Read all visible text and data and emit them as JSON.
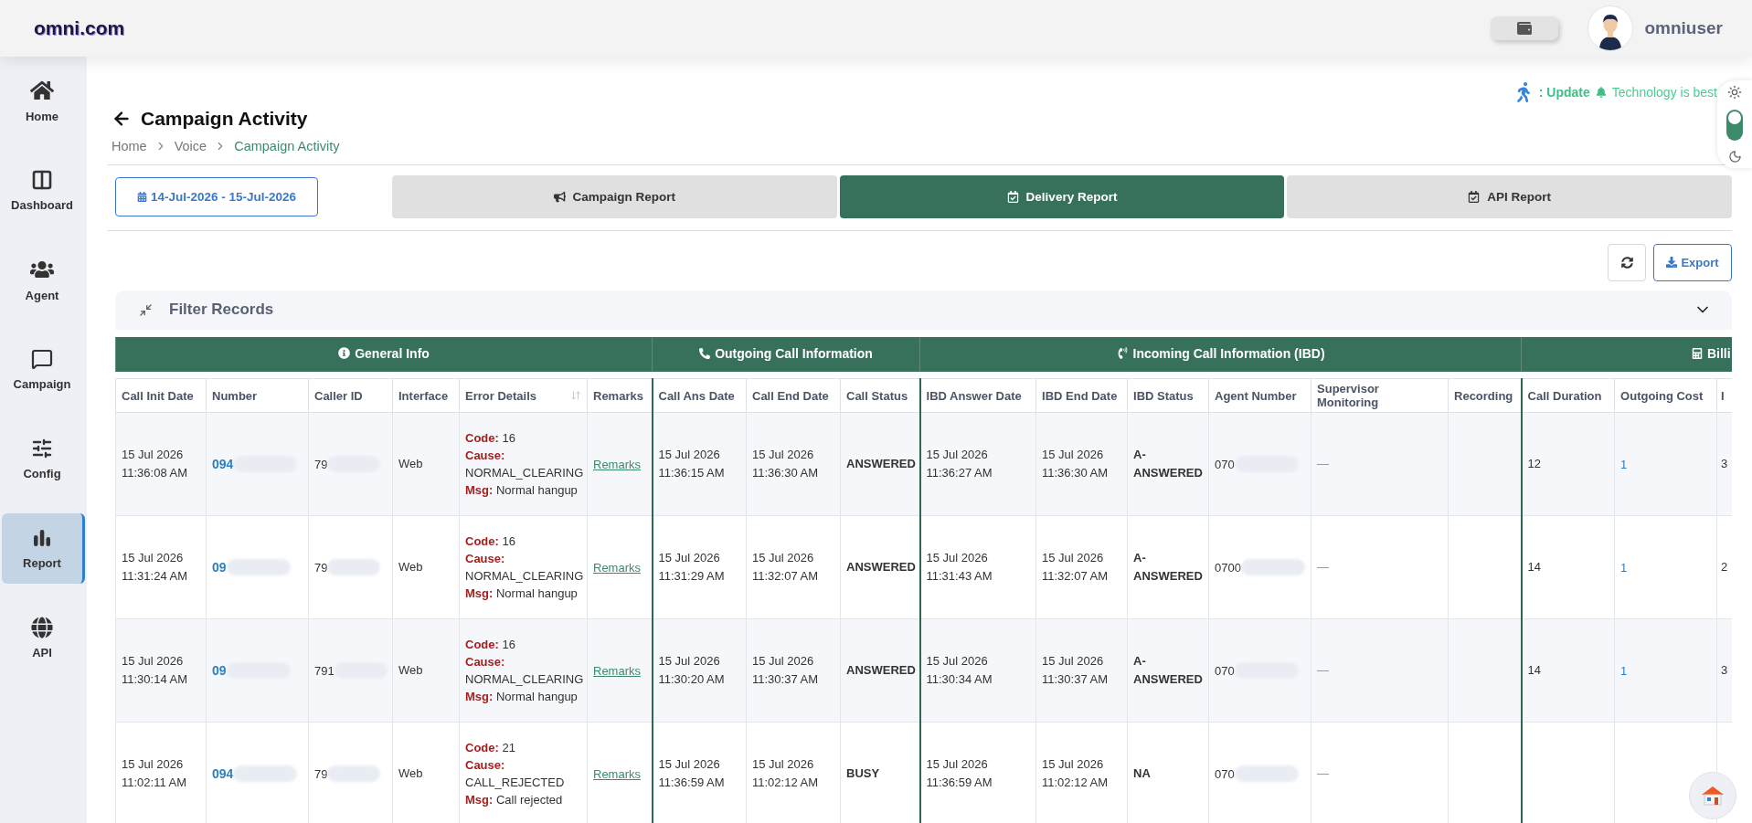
{
  "header": {
    "logo": "omni.com",
    "user": "omniuser"
  },
  "sidebar": {
    "items": [
      {
        "label": "Home",
        "selected": false
      },
      {
        "label": "Dashboard",
        "selected": false
      },
      {
        "label": "Agent",
        "selected": false
      },
      {
        "label": "Campaign",
        "selected": false
      },
      {
        "label": "Config",
        "selected": false
      },
      {
        "label": "Report",
        "selected": true
      },
      {
        "label": "API",
        "selected": false
      }
    ]
  },
  "notice": {
    "label": ": Update",
    "message": "Technology is best"
  },
  "theme_toggle": {
    "light": true
  },
  "page": {
    "title": "Campaign Activity",
    "breadcrumbs": [
      {
        "label": "Home",
        "selected": false
      },
      {
        "label": "Voice",
        "selected": false
      },
      {
        "label": "Campaign Activity",
        "selected": true
      }
    ]
  },
  "date_range": "14-Jul-2026 - 15-Jul-2026",
  "tabs": [
    {
      "label": "Campaign Report",
      "selected": false
    },
    {
      "label": "Delivery Report",
      "selected": true
    },
    {
      "label": "API Report",
      "selected": false
    }
  ],
  "actions": {
    "export": "Export"
  },
  "filter": {
    "title": "Filter Records",
    "expanded": false
  },
  "table": {
    "groups": [
      {
        "label": "General Info"
      },
      {
        "label": "Outgoing Call Information"
      },
      {
        "label": "Incoming Call Information (IBD)"
      },
      {
        "label": "Billi"
      }
    ],
    "columns": [
      {
        "label": "Call Init Date",
        "sortable": false
      },
      {
        "label": "Number",
        "sortable": false
      },
      {
        "label": "Caller ID",
        "sortable": false
      },
      {
        "label": "Interface",
        "sortable": false
      },
      {
        "label": "Error Details",
        "sortable": true
      },
      {
        "label": "Remarks",
        "sortable": false
      },
      {
        "label": "Call Ans Date",
        "sortable": false
      },
      {
        "label": "Call End Date",
        "sortable": false
      },
      {
        "label": "Call Status",
        "sortable": false
      },
      {
        "label": "IBD Answer Date",
        "sortable": false
      },
      {
        "label": "IBD End Date",
        "sortable": false
      },
      {
        "label": "IBD Status",
        "sortable": false
      },
      {
        "label": "Agent Number",
        "sortable": false
      },
      {
        "label": "Supervisor Monitoring",
        "sortable": false
      },
      {
        "label": "Recording",
        "sortable": false
      },
      {
        "label": "Call Duration",
        "sortable": false
      },
      {
        "label": "Outgoing Cost",
        "sortable": false
      },
      {
        "label": "I",
        "sortable": false
      }
    ],
    "rows": [
      {
        "init": "15 Jul 2026\n11:36:08 AM",
        "number": "094",
        "caller_id": "79",
        "interface": "Web",
        "error": [
          "**Code:** 16",
          "**Cause:** NORMAL_CLEARING",
          "**Msg:** Normal hangup"
        ],
        "remarks": "Remarks",
        "ans": "15 Jul 2026\n11:36:15 AM",
        "end": "15 Jul 2026\n11:36:30 AM",
        "status": "ANSWERED",
        "ibd_ans": "15 Jul 2026\n11:36:27 AM",
        "ibd_end": "15 Jul 2026\n11:36:30 AM",
        "ibd_status": "A-ANSWERED",
        "agent": "070",
        "supervisor": "—",
        "duration": "12",
        "cost": "1",
        "column_18": "3"
      },
      {
        "init": "15 Jul 2026\n11:31:24 AM",
        "number": "09",
        "caller_id": "79",
        "interface": "Web",
        "error": [
          "**Code:** 16",
          "**Cause:** NORMAL_CLEARING",
          "**Msg:** Normal hangup"
        ],
        "remarks": "Remarks",
        "ans": "15 Jul 2026\n11:31:29 AM",
        "end": "15 Jul 2026\n11:32:07 AM",
        "status": "ANSWERED",
        "ibd_ans": "15 Jul 2026\n11:31:43 AM",
        "ibd_end": "15 Jul 2026\n11:32:07 AM",
        "ibd_status": "A-ANSWERED",
        "agent": "0700",
        "supervisor": "—",
        "duration": "14",
        "cost": "1",
        "column_18": "2"
      },
      {
        "init": "15 Jul 2026\n11:30:14 AM",
        "number": "09",
        "caller_id": "791",
        "interface": "Web",
        "error": [
          "**Code:** 16",
          "**Cause:** NORMAL_CLEARING",
          "**Msg:** Normal hangup"
        ],
        "remarks": "Remarks",
        "ans": "15 Jul 2026\n11:30:20 AM",
        "end": "15 Jul 2026\n11:30:37 AM",
        "status": "ANSWERED",
        "ibd_ans": "15 Jul 2026\n11:30:34 AM",
        "ibd_end": "15 Jul 2026\n11:30:37 AM",
        "ibd_status": "A-ANSWERED",
        "agent": "070",
        "supervisor": "—",
        "duration": "14",
        "cost": "1",
        "column_18": "3"
      },
      {
        "init": "15 Jul 2026\n11:02:11 AM",
        "number": "094",
        "caller_id": "79",
        "interface": "Web",
        "error": [
          "**Code:** 21",
          "**Cause:** CALL_REJECTED",
          "**Msg:** Call rejected"
        ],
        "remarks": "Remarks",
        "ans": "15 Jul 2026\n11:36:59 AM",
        "end": "15 Jul 2026\n11:02:12 AM",
        "status": "BUSY",
        "ibd_ans": "15 Jul 2026\n11:36:59 AM",
        "ibd_end": "15 Jul 2026\n11:02:12 AM",
        "ibd_status": "NA",
        "agent": "070",
        "supervisor": "—"
      }
    ]
  }
}
